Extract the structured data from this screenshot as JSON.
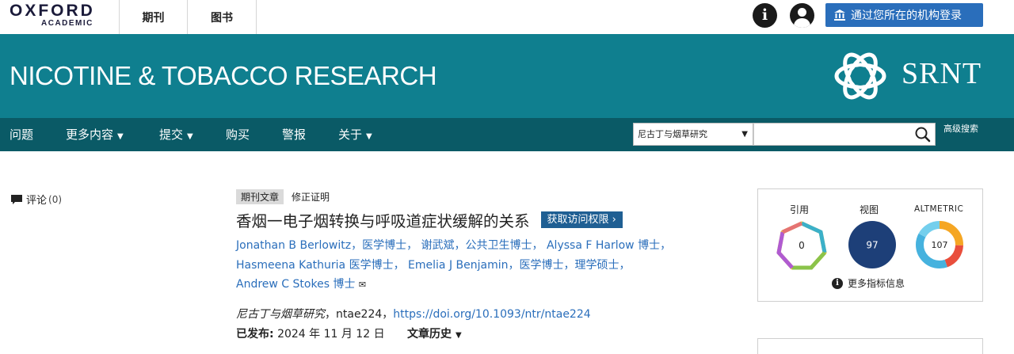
{
  "header": {
    "logo_main": "OXFORD",
    "logo_sub": "ACADEMIC",
    "tabs": [
      {
        "label": "期刊"
      },
      {
        "label": "图书"
      }
    ],
    "signin_label": "通过您所在的机构登录"
  },
  "banner": {
    "journal_title": "NICOTINE & TOBACCO RESEARCH",
    "society": "SRNT"
  },
  "nav": {
    "items": [
      {
        "label": "问题"
      },
      {
        "label": "更多内容"
      },
      {
        "label": "提交"
      },
      {
        "label": "购买"
      },
      {
        "label": "警报"
      },
      {
        "label": "关于"
      }
    ],
    "search_scope": "尼古丁与烟草研究",
    "search_placeholder": "",
    "advanced_search": "高级搜索"
  },
  "sidebar": {
    "comments_label": "评论",
    "comments_count": "(0)"
  },
  "article": {
    "type_badge": "期刊文章",
    "correction_badge": "修正证明",
    "title": "香烟一电子烟转换与呼吸道症状缓解的关系",
    "access_button": "获取访问权限",
    "authors": [
      {
        "name": "Jonathan B Berlowitz",
        "suffix": "，医学博士，"
      },
      {
        "name": "谢武斌",
        "suffix": "，公共卫生博士，"
      },
      {
        "name": "Alyssa F Harlow",
        "suffix": " 博士，"
      },
      {
        "name": "Hasmeena Kathuria",
        "suffix": " 医学博士，"
      },
      {
        "name": "Emelia J Benjamin",
        "suffix": "，医学博士，理学硕士，"
      },
      {
        "name": "Andrew C Stokes",
        "suffix": " 博士"
      }
    ],
    "journal_name": "尼古丁与烟草研究",
    "article_id": "，ntae224，",
    "doi": "https://doi.org/10.1093/ntr/ntae224",
    "published_label": "已发布:",
    "published_date": "2024 年 11 月 12 日",
    "history_label": "文章历史"
  },
  "metrics": {
    "citations_label": "引用",
    "citations_value": "0",
    "views_label": "视图",
    "views_value": "97",
    "altmetric_label": "ALTMETRIC",
    "altmetric_value": "107",
    "more_label": "更多指标信息"
  },
  "colors": {
    "banner": "#0f7f8f",
    "nav": "#0a5a66",
    "link": "#2a6ebb",
    "signin": "#2a6ebb",
    "access": "#1f5f93",
    "views_circle": "#1d3f78"
  }
}
